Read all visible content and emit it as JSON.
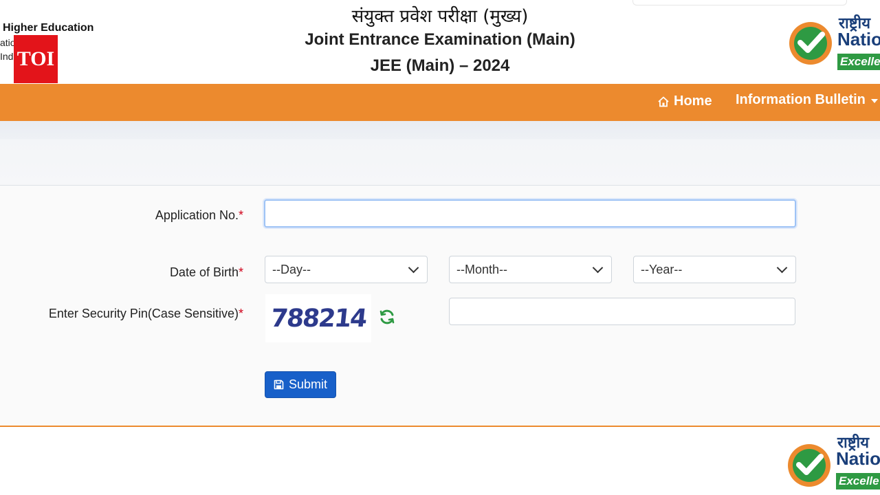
{
  "header": {
    "title_hindi": "संयुक्त प्रवेश परीक्षा (मुख्य)",
    "title_english": "Joint Entrance Examination (Main)",
    "title_year": "JEE (Main) – 2024",
    "left_logo": {
      "line1": "Higher Education",
      "line2": "atio",
      "line3": "Ind"
    },
    "watermark": "TOI",
    "nta_logo": {
      "hindi": "राष्ट्रीय",
      "english": "Nation",
      "tagline": "Excelle"
    }
  },
  "nav": {
    "home": "Home",
    "information_bulletin": "Information Bulletin"
  },
  "form": {
    "application_no": {
      "label": "Application No.",
      "value": ""
    },
    "dob": {
      "label": "Date of Birth",
      "day": "--Day--",
      "month": "--Month--",
      "year": "--Year--"
    },
    "security_pin": {
      "label": "Enter Security Pin(Case Sensitive)",
      "captcha": "788214",
      "value": ""
    },
    "required_marker": "*",
    "submit": "Submit"
  },
  "colors": {
    "navbar": "#ec8a2e",
    "submit": "#1860c9",
    "required": "#d0021b",
    "nta_green": "#2e9a43",
    "nta_blue": "#1a3f7a"
  }
}
